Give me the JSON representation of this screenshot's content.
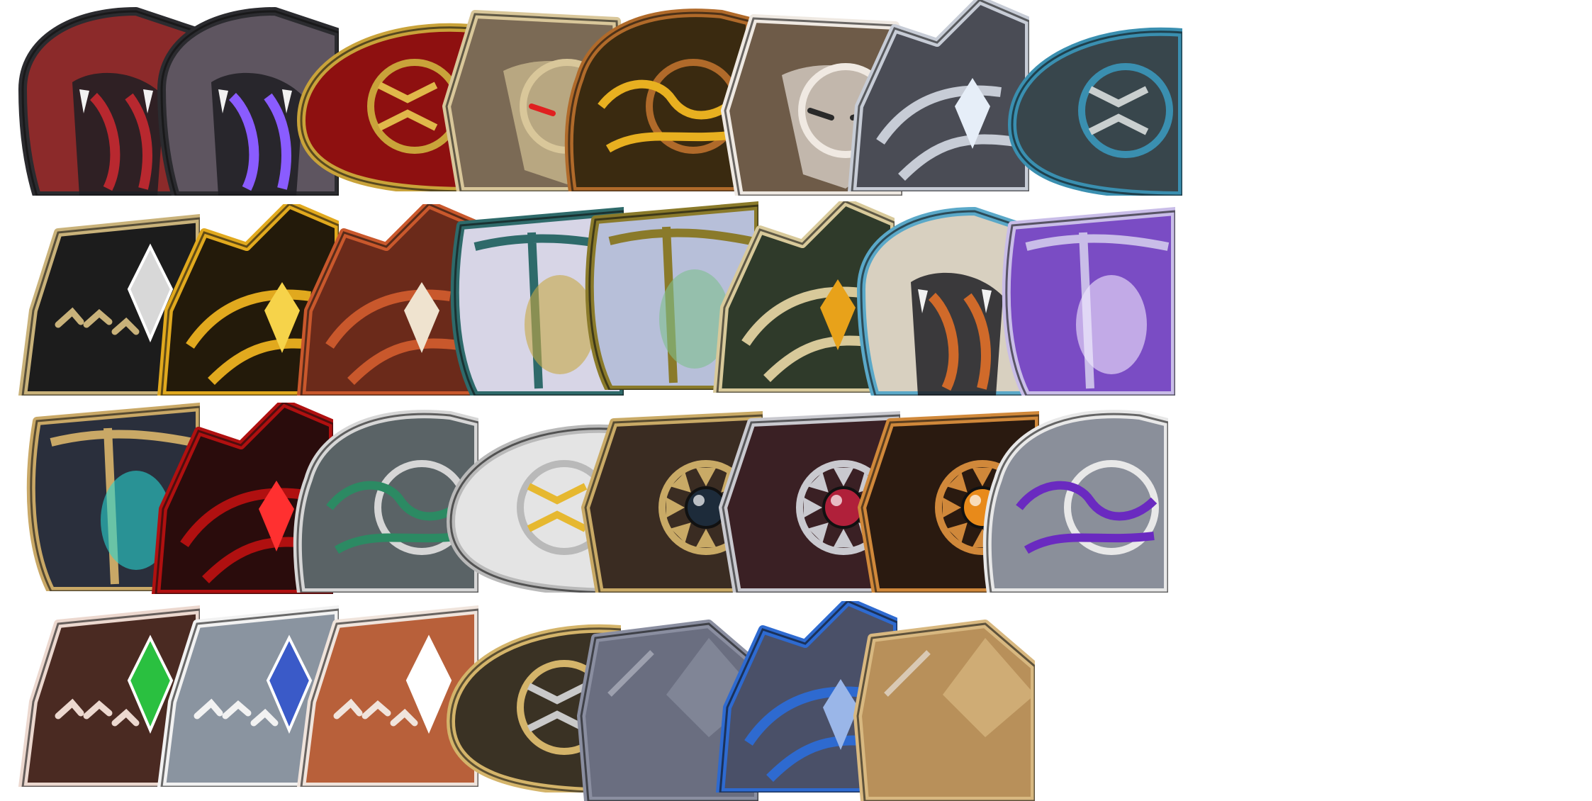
{
  "sprite_sheet": {
    "layout": {
      "rows": 4,
      "columns": 8,
      "filled": 31
    },
    "icons": [
      {
        "name": "crimson-hood-shield-icon",
        "style": "hood",
        "base": "#8c2a2a",
        "trim": "#2b2b2f",
        "accent": "#b8282f"
      },
      {
        "name": "void-hood-shield-icon",
        "style": "hood",
        "base": "#5e5560",
        "trim": "#2b2b2f",
        "accent": "#8a5cff"
      },
      {
        "name": "golden-vine-red-shield-icon",
        "style": "round",
        "base": "#8e1010",
        "trim": "#c9a33a",
        "accent": "#e0b84a"
      },
      {
        "name": "horned-mask-shield-icon",
        "style": "mask",
        "base": "#7b6a55",
        "trim": "#d9c79a",
        "accent": "#e02020"
      },
      {
        "name": "bow-amber-shield-icon",
        "style": "ornate",
        "base": "#3a2a10",
        "trim": "#b06a2a",
        "accent": "#e8b020"
      },
      {
        "name": "cowled-warrior-shield-icon",
        "style": "mask",
        "base": "#6e5b48",
        "trim": "#efe9e2",
        "accent": "#2a2a2a"
      },
      {
        "name": "silver-spire-shield-icon",
        "style": "spike",
        "base": "#4a4c55",
        "trim": "#c7ccd6",
        "accent": "#e6eef8"
      },
      {
        "name": "azure-disc-shield-icon",
        "style": "round",
        "base": "#38464c",
        "trim": "#3a8fb0",
        "accent": "#c9cfcf"
      },
      {
        "name": "black-filigree-shield-icon",
        "style": "kite",
        "base": "#1c1c1c",
        "trim": "#c9b27a",
        "accent": "#d8d8d8"
      },
      {
        "name": "golden-flame-shield-icon",
        "style": "spike",
        "base": "#231a0a",
        "trim": "#e1a91e",
        "accent": "#f6d34a"
      },
      {
        "name": "horned-copper-shield-icon",
        "style": "spike",
        "base": "#6b2a1a",
        "trim": "#c9582c",
        "accent": "#efe3cf"
      },
      {
        "name": "pearl-gilded-shield-icon",
        "style": "heater",
        "base": "#d7d5e6",
        "trim": "#2e6a6a",
        "accent": "#c7a844"
      },
      {
        "name": "jade-lattice-shield-icon",
        "style": "heater",
        "base": "#b7bfd9",
        "trim": "#8a7a2a",
        "accent": "#7fbf8e"
      },
      {
        "name": "winged-emerald-shield-icon",
        "style": "spike",
        "base": "#2f3a2a",
        "trim": "#d8c99a",
        "accent": "#e8a21a"
      },
      {
        "name": "teal-bone-shield-icon",
        "style": "hood",
        "base": "#d8d0c0",
        "trim": "#5aa8c8",
        "accent": "#d06a2a"
      },
      {
        "name": "violet-rune-shield-icon",
        "style": "heater",
        "base": "#7a4cc4",
        "trim": "#c9bde8",
        "accent": "#f1e9ff"
      },
      {
        "name": "cyan-eye-shield-icon",
        "style": "heater",
        "base": "#2a2f3c",
        "trim": "#c9a866",
        "accent": "#2ad6d0"
      },
      {
        "name": "bloodfang-shield-icon",
        "style": "spike",
        "base": "#2a0c0c",
        "trim": "#b01010",
        "accent": "#ff3030"
      },
      {
        "name": "jade-steel-shield-icon",
        "style": "ornate",
        "base": "#5a6366",
        "trim": "#d6d6d6",
        "accent": "#2c8a63"
      },
      {
        "name": "radiant-disc-shield-icon",
        "style": "round",
        "base": "#e4e4e4",
        "trim": "#b9b9b9",
        "accent": "#e6b830"
      },
      {
        "name": "obsidian-orb-shield-icon",
        "style": "orb",
        "base": "#3a2c22",
        "trim": "#c9aa66",
        "accent": "#1d2b3a"
      },
      {
        "name": "ruby-orb-shield-icon",
        "style": "orb",
        "base": "#3a2024",
        "trim": "#c9c9cf",
        "accent": "#b0203a"
      },
      {
        "name": "amber-orb-shield-icon",
        "style": "orb",
        "base": "#2a1a10",
        "trim": "#d0883a",
        "accent": "#e88a1a"
      },
      {
        "name": "amethyst-scroll-shield-icon",
        "style": "ornate",
        "base": "#8a8f9a",
        "trim": "#e8e8e8",
        "accent": "#6a2ac0"
      },
      {
        "name": "emerald-runed-kite-shield-icon",
        "style": "kite",
        "base": "#4a2a22",
        "trim": "#ecd8cf",
        "accent": "#2ac040"
      },
      {
        "name": "sapphire-runed-kite-shield-icon",
        "style": "kite",
        "base": "#8a94a0",
        "trim": "#f2f2f2",
        "accent": "#3a5ac8"
      },
      {
        "name": "copper-runed-kite-shield-icon",
        "style": "kite",
        "base": "#b8603a",
        "trim": "#f0e4dc",
        "accent": "#ffffff"
      },
      {
        "name": "bronze-medallion-shield-icon",
        "style": "round",
        "base": "#3a3224",
        "trim": "#d4b46a",
        "accent": "#c9c9c9"
      },
      {
        "name": "slate-plain-shield-icon",
        "style": "plain",
        "base": "#6a6e80",
        "trim": "#8a8ea0",
        "accent": "#bfc2ce"
      },
      {
        "name": "cobalt-crest-shield-icon",
        "style": "spike",
        "base": "#4a5068",
        "trim": "#2e6ad0",
        "accent": "#9ab6e8"
      },
      {
        "name": "tan-leather-shield-icon",
        "style": "plain",
        "base": "#b8905a",
        "trim": "#d8b880",
        "accent": "#f0f0f0"
      }
    ]
  }
}
